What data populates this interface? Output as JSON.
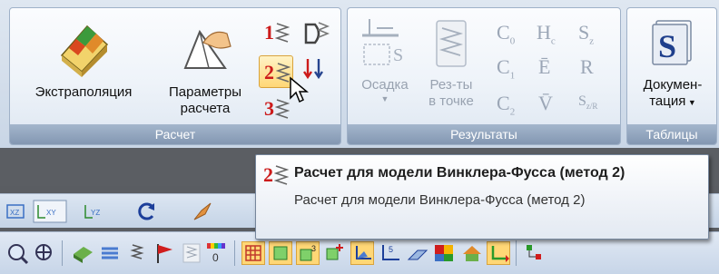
{
  "ribbon": {
    "groups": [
      {
        "label": "Расчет"
      },
      {
        "label": "Результаты"
      },
      {
        "label": "Таблицы"
      }
    ],
    "calc": {
      "extrapolation_label": "Экстраполяция",
      "params_label_line1": "Параметры",
      "params_label_line2": "расчета",
      "method_numbers": [
        "1",
        "2",
        "3"
      ]
    },
    "results": {
      "settlement_label": "Осадка",
      "results_point_line1": "Рез-ты",
      "results_point_line2": "в точке",
      "letters": {
        "c0": "C",
        "c0_sub": "0",
        "c1": "C",
        "c1_sub": "1",
        "c2": "C",
        "c2_sub": "2",
        "hc": "H",
        "hc_sub": "c",
        "e_bar": "Ē",
        "v_bar": "V̄",
        "sz": "S",
        "sz_sub": "z",
        "r": "R",
        "szr": "S",
        "szr_sub": "z/R"
      }
    },
    "tables": {
      "doc_line1": "Докумен-",
      "doc_line2": "тация"
    }
  },
  "tooltip": {
    "icon_number": "2",
    "title": "Расчет для модели Винклера-Фусса (метод 2)",
    "description": "Расчет для модели Винклера-Фусса (метод 2)"
  },
  "colors": {
    "accent_red": "#cc1b1b",
    "group_label_bg": "#8397b2",
    "highlight": "#ffd776"
  }
}
